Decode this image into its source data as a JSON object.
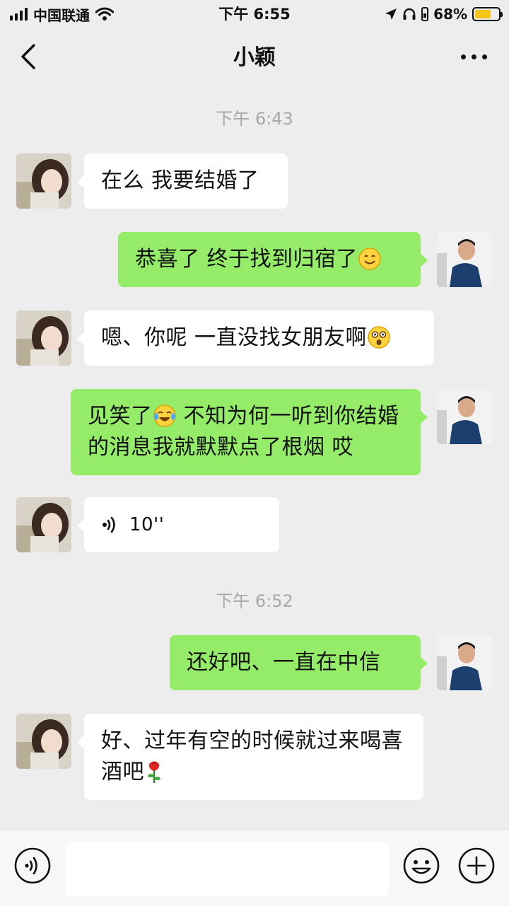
{
  "status_bar": {
    "carrier": "中国联通",
    "time": "下午 6:55",
    "battery_percent": "68%",
    "battery_level": 0.68,
    "icons": [
      "signal-icon",
      "wifi-icon",
      "location-icon",
      "headphones-icon",
      "orientation-lock-icon",
      "battery-charging-icon"
    ]
  },
  "nav": {
    "title": "小颖",
    "back_icon": "chevron-left-icon",
    "more_icon": "more-dots-icon"
  },
  "timestamps": [
    "下午 6:43",
    "下午 6:52"
  ],
  "messages": [
    {
      "from": "them",
      "text": "在么 我要结婚了"
    },
    {
      "from": "me",
      "text": "恭喜了 终于找到归宿了",
      "emoji": "smile-emoji"
    },
    {
      "from": "them",
      "text": "嗯、你呢 一直没找女朋友啊",
      "emoji": "surprised-emoji"
    },
    {
      "from": "me",
      "text_a": "见笑了",
      "emoji": "laugh-cry-emoji",
      "text_b": " 不知为何一听到你结婚的消息我就默默点了根烟 哎"
    },
    {
      "from": "them",
      "type": "voice",
      "duration": "10''"
    },
    {
      "from": "me",
      "text": "还好吧、一直在中信"
    },
    {
      "from": "them",
      "text": "好、过年有空的时候就过来喝喜酒吧",
      "emoji": "rose-emoji"
    }
  ],
  "input_bar": {
    "voice_icon": "voice-input-icon",
    "emoji_icon": "emoji-icon",
    "add_icon": "add-icon",
    "input_value": ""
  },
  "colors": {
    "background": "#ededed",
    "bubble_out": "#95ec69",
    "bubble_in": "#ffffff",
    "timestamp": "#a8a8a8"
  }
}
